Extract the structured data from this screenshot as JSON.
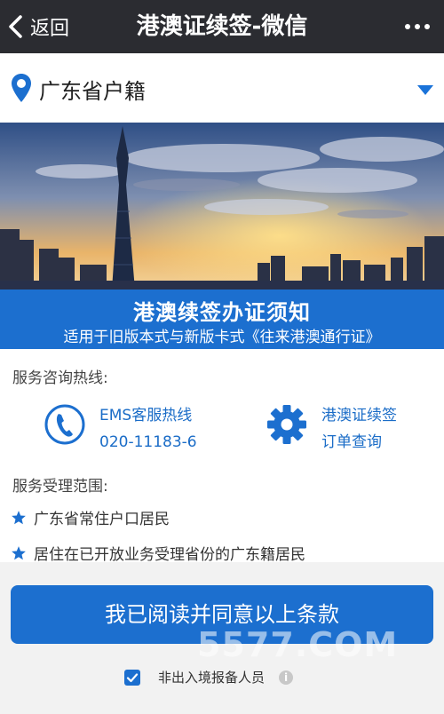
{
  "nav": {
    "back_label": "返回",
    "title": "港澳证续签-微信"
  },
  "region": {
    "label": "广东省户籍"
  },
  "notice": {
    "title": "港澳续签办证须知",
    "subtitle": "适用于旧版本式与新版卡式《往来港澳通行证》"
  },
  "hotline_section": {
    "title": "服务咨询热线:",
    "ems": {
      "line1": "EMS客服热线",
      "line2": "020-11183-6",
      "icon": "phone-icon"
    },
    "order": {
      "line1": "港澳证续签",
      "line2": "订单查询",
      "icon": "gear-icon"
    }
  },
  "scope_section": {
    "title": "服务受理范围:",
    "items": [
      "广东省常住户口居民",
      "居住在已开放业务受理省份的广东籍居民"
    ]
  },
  "agree_button": "我已阅读并同意以上条款",
  "watermark": "5577.COM",
  "checkbox": {
    "label": "非出入境报备人员",
    "checked": true
  },
  "colors": {
    "nav_bg": "#2b2c31",
    "accent": "#1c6fcf"
  }
}
